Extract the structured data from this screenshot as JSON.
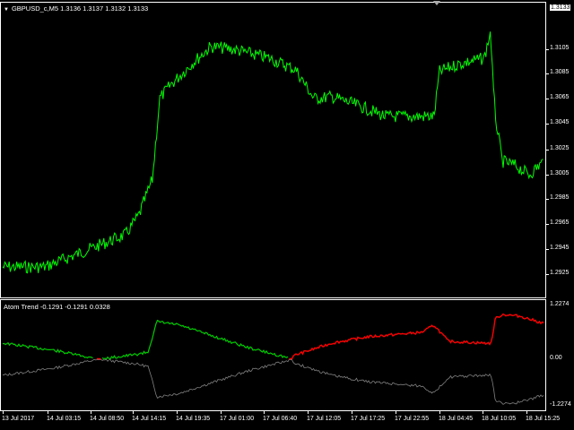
{
  "main_chart": {
    "symbol_label": "GBPUSD_c,M5",
    "ohlc": "1.3136 1.3137 1.3132 1.3133",
    "current_price": "1.3133",
    "price_labels": [
      "1.3105",
      "1.3085",
      "1.3065",
      "1.3045",
      "1.3025",
      "1.3005",
      "1.2985",
      "1.2965",
      "1.2945",
      "1.2925"
    ],
    "line_color": "#00ff00"
  },
  "indicator": {
    "label": "Atom Trend",
    "values": "-0.1291 -0.1291 0.0328",
    "y_labels": [
      "1.2274",
      "0.00",
      "-1.2274"
    ],
    "colors": {
      "up": "#ff0000",
      "down": "#00cc00",
      "mirror": "#808080"
    }
  },
  "time_axis": {
    "labels": [
      "13 Jul 2017",
      "14 Jul 03:15",
      "14 Jul 08:50",
      "14 Jul 14:15",
      "14 Jul 19:35",
      "17 Jul 01:00",
      "17 Jul 06:40",
      "17 Jul 12:05",
      "17 Jul 17:25",
      "17 Jul 22:55",
      "18 Jul 04:45",
      "18 Jul 10:05",
      "18 Jul 15:25"
    ]
  },
  "chart_data": [
    {
      "type": "line",
      "symbol": "GBPUSD_c,M5",
      "ylim": [
        1.2915,
        1.3135
      ],
      "x": [
        "13 Jul 2017",
        "14 Jul 03:15",
        "14 Jul 08:50",
        "14 Jul 14:15",
        "14 Jul 19:35",
        "17 Jul 01:00",
        "17 Jul 06:40",
        "17 Jul 12:05",
        "17 Jul 17:25",
        "17 Jul 22:55",
        "18 Jul 04:45",
        "18 Jul 10:05",
        "18 Jul 15:25"
      ],
      "y": [
        1.294,
        1.295,
        1.2965,
        1.299,
        1.3095,
        1.3105,
        1.3095,
        1.308,
        1.3065,
        1.306,
        1.309,
        1.31,
        1.301
      ]
    },
    {
      "type": "line",
      "name": "Atom Trend",
      "ylim": [
        -1.35,
        1.35
      ],
      "x": [
        "13 Jul 2017",
        "14 Jul 03:15",
        "14 Jul 08:50",
        "14 Jul 14:15",
        "14 Jul 19:35",
        "17 Jul 01:00",
        "17 Jul 06:40",
        "17 Jul 12:05",
        "17 Jul 17:25",
        "17 Jul 22:55",
        "18 Jul 04:45",
        "18 Jul 10:05",
        "18 Jul 15:25"
      ],
      "y": [
        -0.3,
        -0.15,
        0.0,
        -0.1,
        -1.0,
        -0.7,
        -0.3,
        0.15,
        0.45,
        0.7,
        0.45,
        1.25,
        1.05
      ]
    }
  ]
}
